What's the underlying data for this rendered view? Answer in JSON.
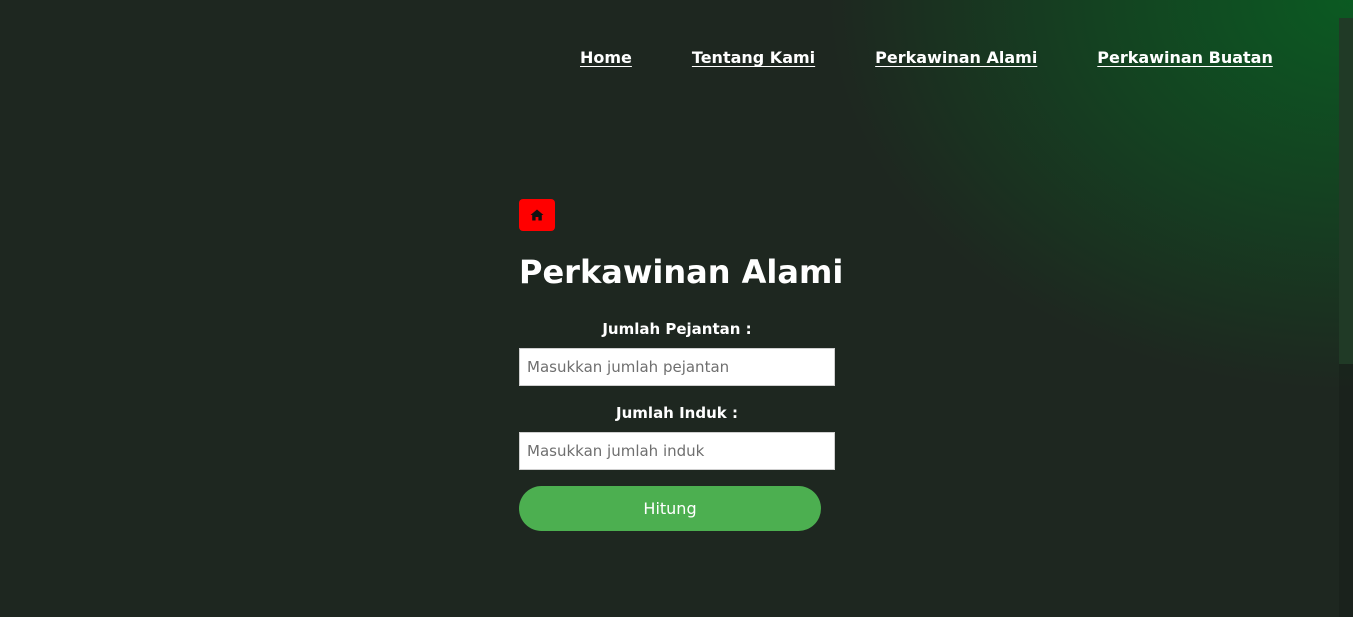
{
  "nav": {
    "items": [
      {
        "label": "Home"
      },
      {
        "label": "Tentang Kami"
      },
      {
        "label": "Perkawinan Alami"
      },
      {
        "label": "Perkawinan Buatan"
      }
    ]
  },
  "home_button": {
    "icon": "home-icon",
    "color": "#ff0000"
  },
  "page": {
    "title": "Perkawinan Alami"
  },
  "form": {
    "pejantan": {
      "label": "Jumlah Pejantan :",
      "placeholder": "Masukkan jumlah pejantan",
      "value": ""
    },
    "induk": {
      "label": "Jumlah Induk :",
      "placeholder": "Masukkan jumlah induk",
      "value": ""
    },
    "submit_label": "Hitung",
    "submit_color": "#4caf50"
  }
}
